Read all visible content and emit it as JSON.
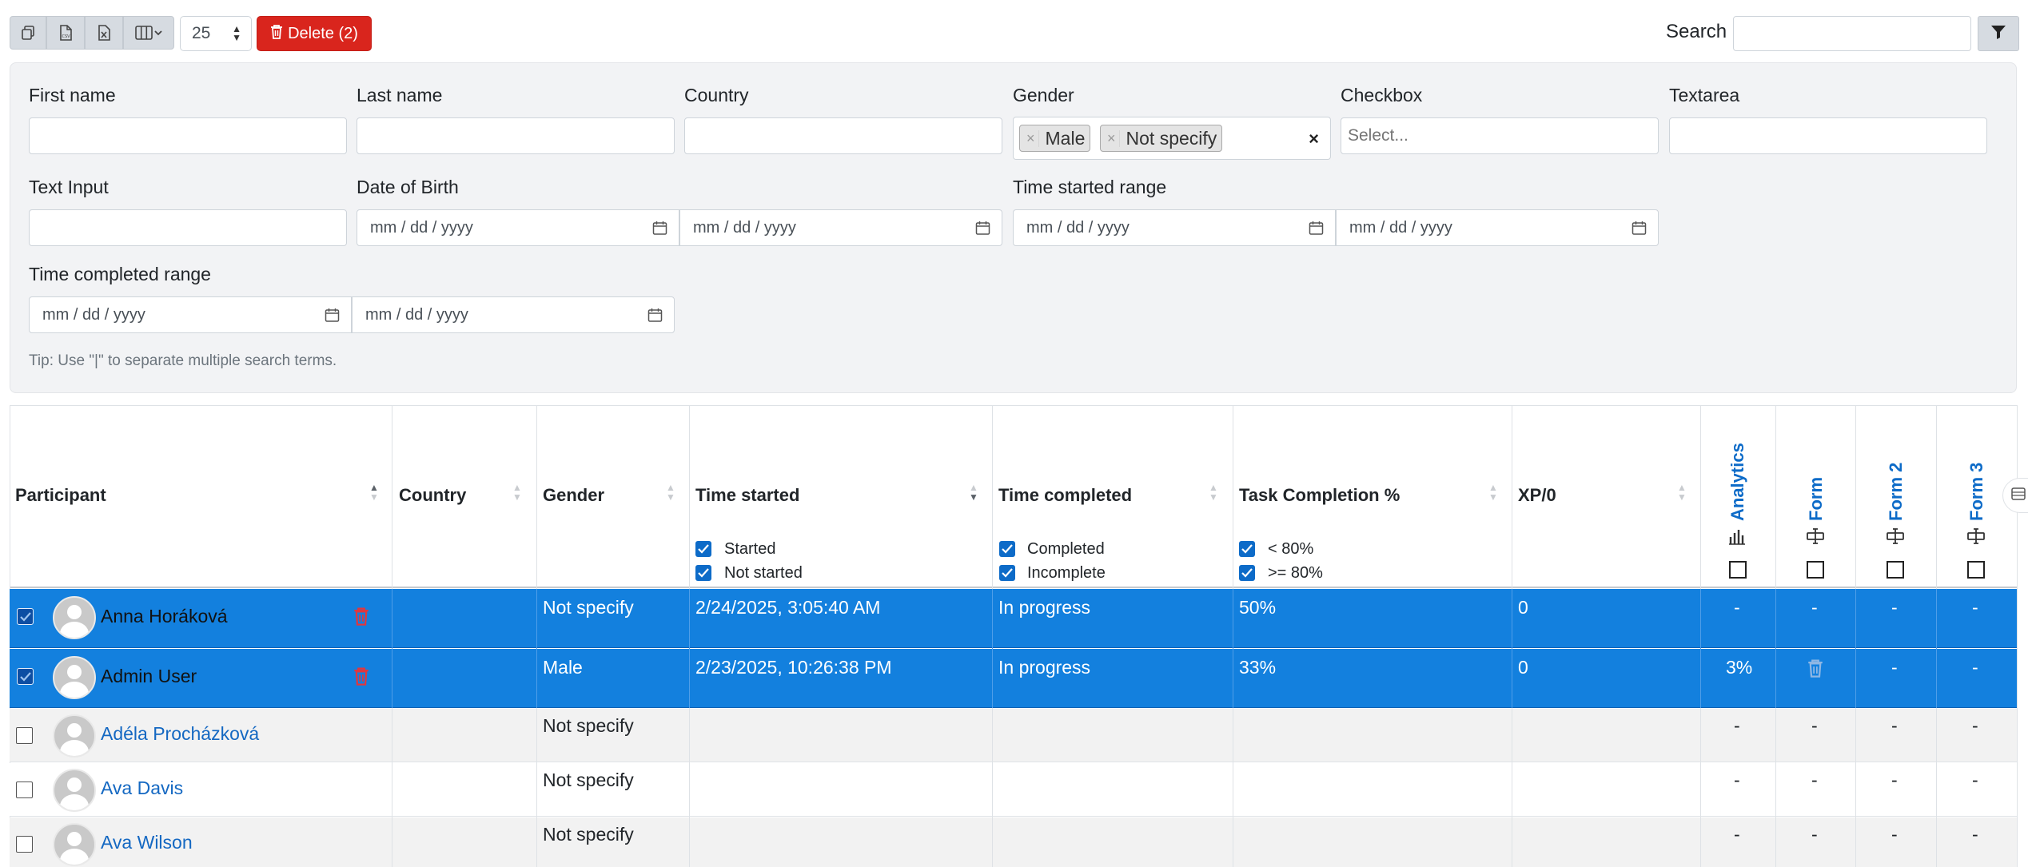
{
  "toolbar": {
    "buttons": [
      "copy-icon",
      "csv-icon",
      "excel-icon",
      "columns-icon"
    ],
    "per_page": "25",
    "delete_label": "Delete (2)",
    "search_label": "Search",
    "search_value": ""
  },
  "filters": {
    "first_name": "First name",
    "last_name": "Last name",
    "country": "Country",
    "gender": "Gender",
    "gender_selected": [
      "Male",
      "Not specify"
    ],
    "checkbox": "Checkbox",
    "checkbox_placeholder": "Select...",
    "textarea": "Textarea",
    "text_input": "Text Input",
    "date_of_birth": "Date of Birth",
    "time_started_range": "Time started range",
    "time_completed_range": "Time completed range",
    "date_placeholder": "mm / dd / yyyy",
    "tip": "Tip: Use \"|\" to separate multiple search terms."
  },
  "table": {
    "headers": {
      "participant": "Participant",
      "country": "Country",
      "gender": "Gender",
      "time_started": "Time started",
      "time_completed": "Time completed",
      "task_completion": "Task Completion %",
      "xp": "XP/0",
      "analytics": "Analytics",
      "form": "Form",
      "form2": "Form 2",
      "form3": "Form 3"
    },
    "header_filters": {
      "started": "Started",
      "not_started": "Not started",
      "completed": "Completed",
      "incomplete": "Incomplete",
      "lt80": "< 80%",
      "gte80": ">= 80%"
    },
    "rows": [
      {
        "name": "Anna Horáková",
        "country": "",
        "gender": "Not specify",
        "time_started": "2/24/2025, 3:05:40 AM",
        "time_completed": "In progress",
        "task": "50%",
        "xp": "0",
        "analytics": "-",
        "form": "-",
        "form2": "-",
        "form3": "-",
        "selected": true
      },
      {
        "name": "Admin User",
        "country": "",
        "gender": "Male",
        "time_started": "2/23/2025, 10:26:38 PM",
        "time_completed": "In progress",
        "task": "33%",
        "xp": "0",
        "analytics": "3%",
        "form": "",
        "form2": "-",
        "form3": "-",
        "selected": true
      },
      {
        "name": "Adéla Procházková",
        "country": "",
        "gender": "Not specify",
        "time_started": "",
        "time_completed": "",
        "task": "",
        "xp": "",
        "analytics": "-",
        "form": "-",
        "form2": "-",
        "form3": "-",
        "selected": false
      },
      {
        "name": "Ava Davis",
        "country": "",
        "gender": "Not specify",
        "time_started": "",
        "time_completed": "",
        "task": "",
        "xp": "",
        "analytics": "-",
        "form": "-",
        "form2": "-",
        "form3": "-",
        "selected": false
      },
      {
        "name": "Ava Wilson",
        "country": "",
        "gender": "Not specify",
        "time_started": "",
        "time_completed": "",
        "task": "",
        "xp": "",
        "analytics": "-",
        "form": "-",
        "form2": "-",
        "form3": "-",
        "selected": false
      }
    ]
  },
  "colors": {
    "selected_row": "#1380de",
    "delete_button": "#d9251d",
    "link": "#1468c2",
    "checkbox_on": "#0d6bc8"
  }
}
